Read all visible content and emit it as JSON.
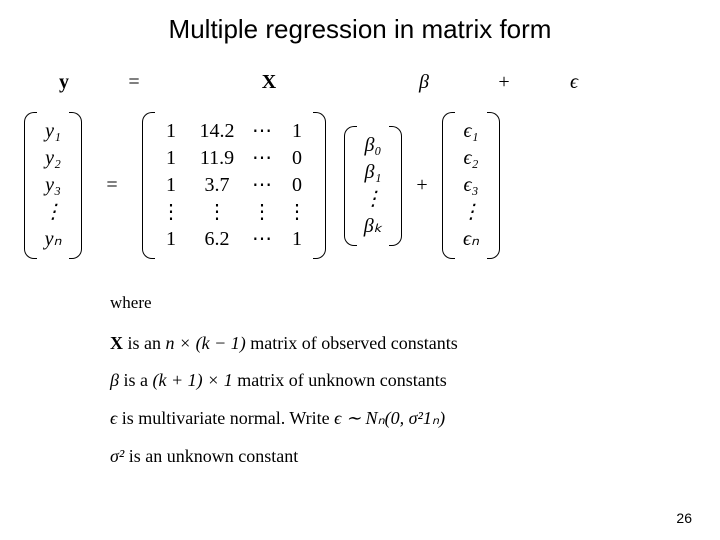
{
  "title": "Multiple regression in matrix form",
  "sym": {
    "y": "y",
    "eq": "=",
    "X": "X",
    "beta": "β",
    "plus": "+",
    "eps": "ϵ"
  },
  "yvec": [
    "y₁",
    "y₂",
    "y₃",
    "⋮",
    "yₙ"
  ],
  "Xmat": {
    "c1": [
      "1",
      "1",
      "1",
      "⋮",
      "1"
    ],
    "c2": [
      "14.2",
      "11.9",
      "3.7",
      "⋮",
      "6.2"
    ],
    "c3": [
      "⋯",
      "⋯",
      "⋯",
      "⋮",
      "⋯"
    ],
    "c4": [
      "1",
      "0",
      "0",
      "⋮",
      "1"
    ]
  },
  "bvec": [
    "β₀",
    "β₁",
    "⋮",
    "βₖ"
  ],
  "evec": [
    "ϵ₁",
    "ϵ₂",
    "ϵ₃",
    "⋮",
    "ϵₙ"
  ],
  "defs": {
    "where": "where",
    "l1a": "X",
    "l1b": " is an ",
    "l1c": "n × (k − 1)",
    "l1d": " matrix of observed constants",
    "l2a": "β",
    "l2b": " is a ",
    "l2c": "(k + 1) × 1",
    "l2d": " matrix of unknown constants",
    "l3a": "ϵ",
    "l3b": " is multivariate normal. Write ",
    "l3c": "ϵ ∼ Nₙ(0, σ²1ₙ)",
    "l4a": "σ²",
    "l4b": " is an unknown constant"
  },
  "page": "26"
}
